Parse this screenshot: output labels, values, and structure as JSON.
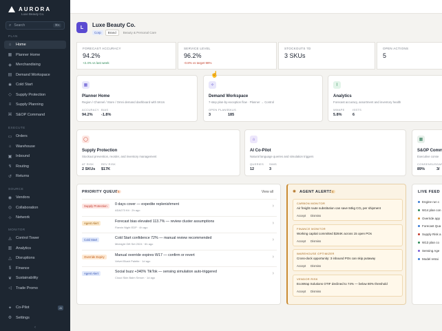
{
  "sidebar": {
    "brand": "AURORA",
    "brand_sub": "Luxe Beauty Co.",
    "search_placeholder": "Search",
    "search_shortcut": "⌘K",
    "sections": {
      "plan": "PLAN",
      "execute": "EXECUTE",
      "source": "SOURCE",
      "monitor": "MONITOR"
    },
    "plan_items": [
      {
        "label": "Home",
        "icon": "home-icon",
        "glyph": "⌂"
      },
      {
        "label": "Planner Home",
        "icon": "grid-icon",
        "glyph": "▦"
      },
      {
        "label": "Merchandising",
        "icon": "tag-icon",
        "glyph": "◈"
      },
      {
        "label": "Demand Workspace",
        "icon": "chart-icon",
        "glyph": "▤"
      },
      {
        "label": "Cold Start",
        "icon": "snowflake-icon",
        "glyph": "✱"
      },
      {
        "label": "Supply Protection",
        "icon": "shield-icon",
        "glyph": "◇"
      },
      {
        "label": "Supply Planning",
        "icon": "layers-icon",
        "glyph": "≡"
      },
      {
        "label": "S&OP Command",
        "icon": "command-icon",
        "glyph": "⌘"
      }
    ],
    "execute_items": [
      {
        "label": "Orders",
        "icon": "cart-icon",
        "glyph": "▭"
      },
      {
        "label": "Warehouse",
        "icon": "warehouse-icon",
        "glyph": "⌂"
      },
      {
        "label": "Inbound",
        "icon": "inbox-icon",
        "glyph": "▣"
      },
      {
        "label": "Routing",
        "icon": "route-icon",
        "glyph": "↯"
      },
      {
        "label": "Returns",
        "icon": "return-icon",
        "glyph": "↺"
      }
    ],
    "source_items": [
      {
        "label": "Vendors",
        "icon": "users-icon",
        "glyph": "◉"
      },
      {
        "label": "Collaboration",
        "icon": "handshake-icon",
        "glyph": "◎"
      },
      {
        "label": "Network",
        "icon": "network-icon",
        "glyph": "⊹"
      }
    ],
    "monitor_items": [
      {
        "label": "Control Tower",
        "icon": "tower-icon",
        "glyph": "◬"
      },
      {
        "label": "Analytics",
        "icon": "bar-chart-icon",
        "glyph": "▥"
      },
      {
        "label": "Disruptions",
        "icon": "alert-icon",
        "glyph": "△"
      },
      {
        "label": "Finance",
        "icon": "dollar-icon",
        "glyph": "$"
      },
      {
        "label": "Sustainability",
        "icon": "leaf-icon",
        "glyph": "❦"
      },
      {
        "label": "Trade Promo",
        "icon": "megaphone-icon",
        "glyph": "◁"
      }
    ],
    "bottom_items": [
      {
        "label": "Co-Pilot",
        "icon": "sparkle-icon",
        "glyph": "✦",
        "badge": "AI"
      },
      {
        "label": "Settings",
        "icon": "gear-icon",
        "glyph": "⚙"
      }
    ]
  },
  "header": {
    "logo_letter": "L",
    "title": "Luxe Beauty Co.",
    "tags": [
      "Corp",
      "Brand",
      "Beauty & Personal Care"
    ]
  },
  "kpis": [
    {
      "label": "FORECAST ACCURACY",
      "value": "94.2%",
      "sub": "+2.4% vs last week",
      "tone": "pos"
    },
    {
      "label": "SERVICE LEVEL",
      "value": "96.2%",
      "sub": "-0.8% vs target 98%",
      "tone": "neg"
    },
    {
      "label": "STOCKOUTS 7D",
      "value": "3 SKUs",
      "sub": "",
      "tone": ""
    },
    {
      "label": "OPEN ACTIONS",
      "value": "5",
      "sub": "",
      "tone": ""
    }
  ],
  "modules": [
    {
      "title": "Planner Home",
      "desc": "Region / Channel / Store / Omni demand dashboard with SKUs",
      "icon": "grid-icon",
      "glyph": "▦",
      "metrics": [
        {
          "label": "ACCURACY",
          "value": "94.2%"
        },
        {
          "label": "BIAS",
          "value": "-1.8%"
        }
      ]
    },
    {
      "title": "Demand Workspace",
      "desc": "7-step plan-by-exception flow · Planner → Control",
      "icon": "sparkle-icon",
      "glyph": "✧",
      "metrics": [
        {
          "label": "OPEN PLANS",
          "value": "3"
        },
        {
          "label": "SKUS",
          "value": "185"
        }
      ]
    },
    {
      "title": "Analytics",
      "desc": "Forecast accuracy, assortment and inventory health",
      "icon": "trend-icon",
      "glyph": "⌇",
      "metrics": [
        {
          "label": "WMAPE",
          "value": "5.8%"
        },
        {
          "label": "ISSTS",
          "value": "6"
        }
      ]
    },
    {
      "title": "Supply Protection",
      "desc": "Stockout prevention, reorder, and inventory management",
      "icon": "shield-icon",
      "glyph": "◯",
      "metrics": [
        {
          "label": "AT RISK",
          "value": "2 SKUs"
        },
        {
          "label": "REV RISK",
          "value": "$17K"
        }
      ]
    },
    {
      "title": "AI Co-Pilot",
      "desc": "Natural language queries and simulation triggers",
      "icon": "bot-icon",
      "glyph": "⌂",
      "metrics": [
        {
          "label": "QUERIES",
          "value": "12"
        },
        {
          "label": "SIMS",
          "value": "3"
        }
      ]
    },
    {
      "title": "S&OP Comma",
      "desc": "Executive conse",
      "icon": "command-icon",
      "glyph": "▦",
      "metrics": [
        {
          "label": "CONSENSUS",
          "value": "89%"
        },
        {
          "label": "GAP",
          "value": "3/"
        }
      ]
    }
  ],
  "priority_queue": {
    "title": "PRIORITY QUEUE",
    "count": "5",
    "view_all": "View all",
    "rows": [
      {
        "pill": "Supply Protection",
        "pill_bg": "#fde4e1",
        "pill_fg": "#c23b2e",
        "title": "0 days cover — expedite replenishment",
        "sub": "ADA273 Kit · 2h ago"
      },
      {
        "pill": "Agent Alert",
        "pill_bg": "#fbe9cc",
        "pill_fg": "#a0600e",
        "title": "Forecast bias elevated 113.7% — review cluster assumptions",
        "sub": "Flamin Night EDP · 4h ago"
      },
      {
        "pill": "Cold Start",
        "pill_bg": "#e1e9fb",
        "pill_fg": "#3655b3",
        "title": "Cold Start confidence 72% — manual review recommended",
        "sub": "Midnight Gift Set 2024 · 6h ago"
      },
      {
        "pill": "Override Expiry",
        "pill_bg": "#fde9d4",
        "pill_fg": "#c05a12",
        "title": "Manual override expires W17 — confirm or revert",
        "sub": "Velvet Blush Palette · 1d ago"
      },
      {
        "pill": "Agent Alert",
        "pill_bg": "#e1e9fb",
        "pill_fg": "#3655b3",
        "title": "Social buzz +340% TikTok — sensing simulation auto-triggered",
        "sub": "Cloud Skin Balm Serum · 1d ago"
      }
    ]
  },
  "agent_alerts": {
    "title": "AGENT ALERTS",
    "count": "4",
    "accept": "Accept",
    "dismiss": "Dismiss",
    "items": [
      {
        "head": "CARBON MONITOR",
        "body": "Air freight route substitution can save 84kg CO₂ per shipment"
      },
      {
        "head": "FINANCE MONITOR",
        "body": "Working capital committed $284K across 15 open POs"
      },
      {
        "head": "WAREHOUSE OPTIMIZER",
        "body": "Cross-dock opportunity: 3 inbound POs can skip putaway"
      },
      {
        "head": "VENDOR RISK",
        "body": "EcoWrap Solutions OTIF declined to 74% — below 80% threshold"
      }
    ]
  },
  "live_feed": {
    "title": "LIVE FEED",
    "items": [
      {
        "text": "Engine run c",
        "color": "#3a7bd5"
      },
      {
        "text": "W14 plan con",
        "color": "#2e8a57"
      },
      {
        "text": "Override app",
        "color": "#d98a1f"
      },
      {
        "text": "Forecast Qua",
        "color": "#3a7bd5"
      },
      {
        "text": "Supply Risk a",
        "color": "#c23b2e"
      },
      {
        "text": "W13 plan co",
        "color": "#2e8a57"
      },
      {
        "text": "Sensing Age",
        "color": "#7b5bd6"
      },
      {
        "text": "Model retrai",
        "color": "#3a7bd5"
      }
    ]
  }
}
